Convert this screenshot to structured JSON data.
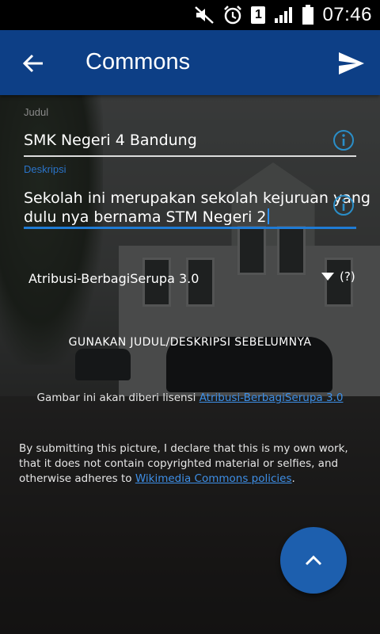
{
  "status_bar": {
    "time": "07:46",
    "sim_slot": "1",
    "icons": [
      "mute-icon",
      "alarm-icon",
      "sim-badge",
      "signal-icon",
      "battery-icon"
    ]
  },
  "app_bar": {
    "title": "Commons",
    "back_icon": "arrow-back-icon",
    "send_icon": "send-icon",
    "color": "#0d3f86"
  },
  "form": {
    "title_field": {
      "label": "Judul",
      "value": "SMK Negeri 4 Bandung"
    },
    "description_field": {
      "label": "Deskripsi",
      "value_line1": "Sekolah ini merupakan sekolah kejuruan yang",
      "value_line2": "dulu nya bernama STM Negeri 2"
    },
    "license_select": {
      "selected": "Atribusi-BerbagiSerupa 3.0",
      "help": "(?)"
    },
    "previous_button": "GUNAKAN JUDUL/DESKRIPSI SEBELUMNYA",
    "license_note": {
      "prefix": "Gambar ini akan diberi lisensi ",
      "link": "Atribusi-BerbagiSerupa 3.0"
    },
    "declaration": {
      "text": "By submitting this picture, I declare that this is my own work, that it does not contain copyrighted material or selfies, and otherwise adheres to ",
      "link": "Wikimedia Commons policies",
      "suffix": "."
    }
  },
  "fab": {
    "icon": "chevron-up-icon",
    "color": "#1d5fae"
  },
  "colors": {
    "accent": "#1f7bd4",
    "link": "#3e8fe6",
    "info": "#2a8ec8"
  }
}
